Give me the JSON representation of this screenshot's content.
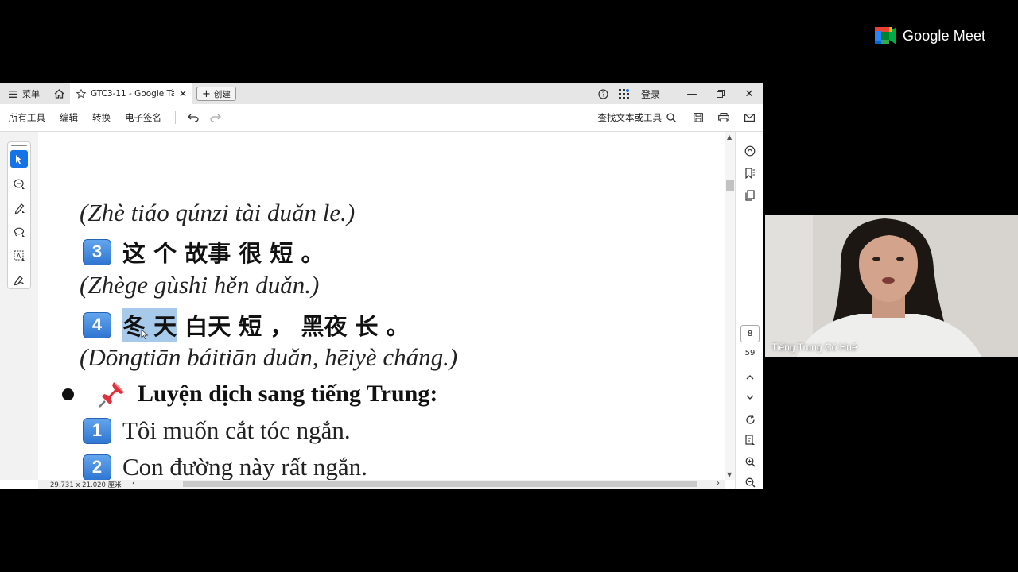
{
  "meet": {
    "brand": "Google Meet"
  },
  "tabbar": {
    "menu_label": "菜单",
    "tab_title": "GTC3-11 - Google Tài...",
    "new_label": "创建",
    "login_label": "登录"
  },
  "toolbar": {
    "items": [
      "所有工具",
      "编辑",
      "转换",
      "电子签名"
    ],
    "search_label": "查找文本或工具"
  },
  "doc": {
    "line1_pinyin": "(Zhè tiáo qúnzi tài duǎn le.)",
    "line2_num": "3",
    "line2_hanzi": "这 个 故事 很 短 。",
    "line3_pinyin": "(Zhège gùshi hěn duǎn.)",
    "line4_num": "4",
    "line4_hl": "冬 天",
    "line4_rest": " 白天 短 ， 黑夜 长 。",
    "line5_pinyin": "(Dōngtiān báitiān duǎn, hēiyè cháng.)",
    "heading": "Luyện dịch sang tiếng Trung:",
    "viet1_num": "1",
    "viet1": "Tôi muốn cắt tóc ngắn.",
    "viet2_num": "2",
    "viet2": "Con đường này rất ngắn."
  },
  "status": {
    "dimensions": "29.731 x 21.020 厘米"
  },
  "pager": {
    "current": "8",
    "total": "59"
  },
  "participant": {
    "name": "Tiếng Trung Cô Huế"
  }
}
